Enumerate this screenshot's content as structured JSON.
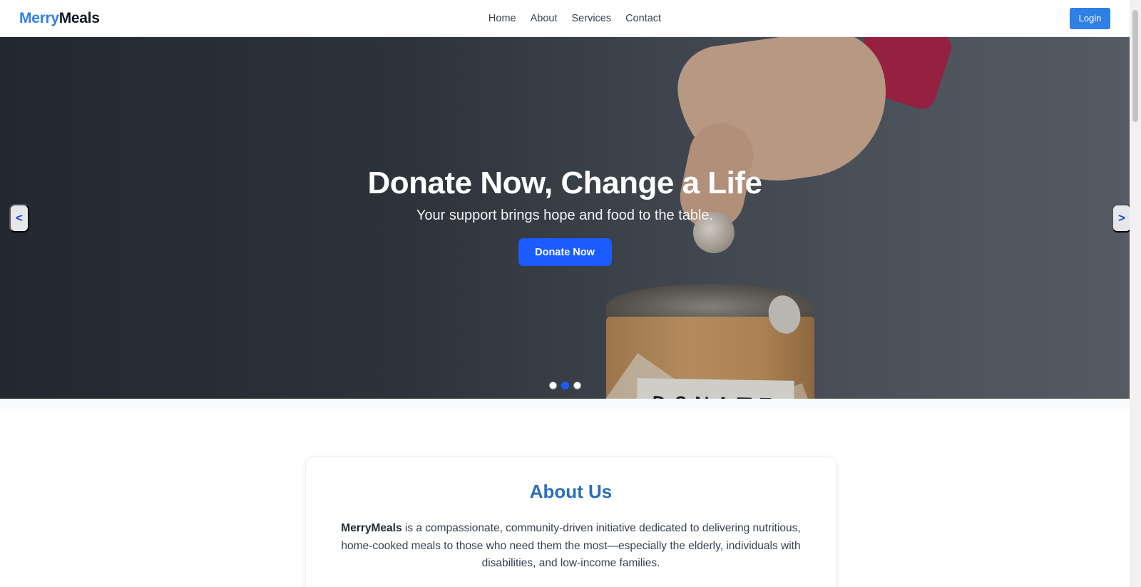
{
  "header": {
    "logo_part1": "Merry",
    "logo_part2": "Meals",
    "nav": [
      {
        "label": "Home"
      },
      {
        "label": "About"
      },
      {
        "label": "Services"
      },
      {
        "label": "Contact"
      }
    ],
    "login_label": "Login"
  },
  "hero": {
    "title": "Donate Now, Change a Life",
    "subtitle": "Your support brings hope and food to the table.",
    "cta_label": "Donate Now",
    "prev_label": "<",
    "next_label": ">",
    "image_label_text": "DONATE",
    "slides_count": 3,
    "active_slide": 2
  },
  "about": {
    "title": "About Us",
    "brand": "MerryMeals",
    "text": " is a compassionate, community-driven initiative dedicated to delivering nutritious, home-cooked meals to those who need them the most—especially the elderly, individuals with disabilities, and low-income families."
  },
  "colors": {
    "brand_blue": "#2f7fe6",
    "cta_blue": "#1a5cff",
    "about_title": "#2a6fb8"
  }
}
